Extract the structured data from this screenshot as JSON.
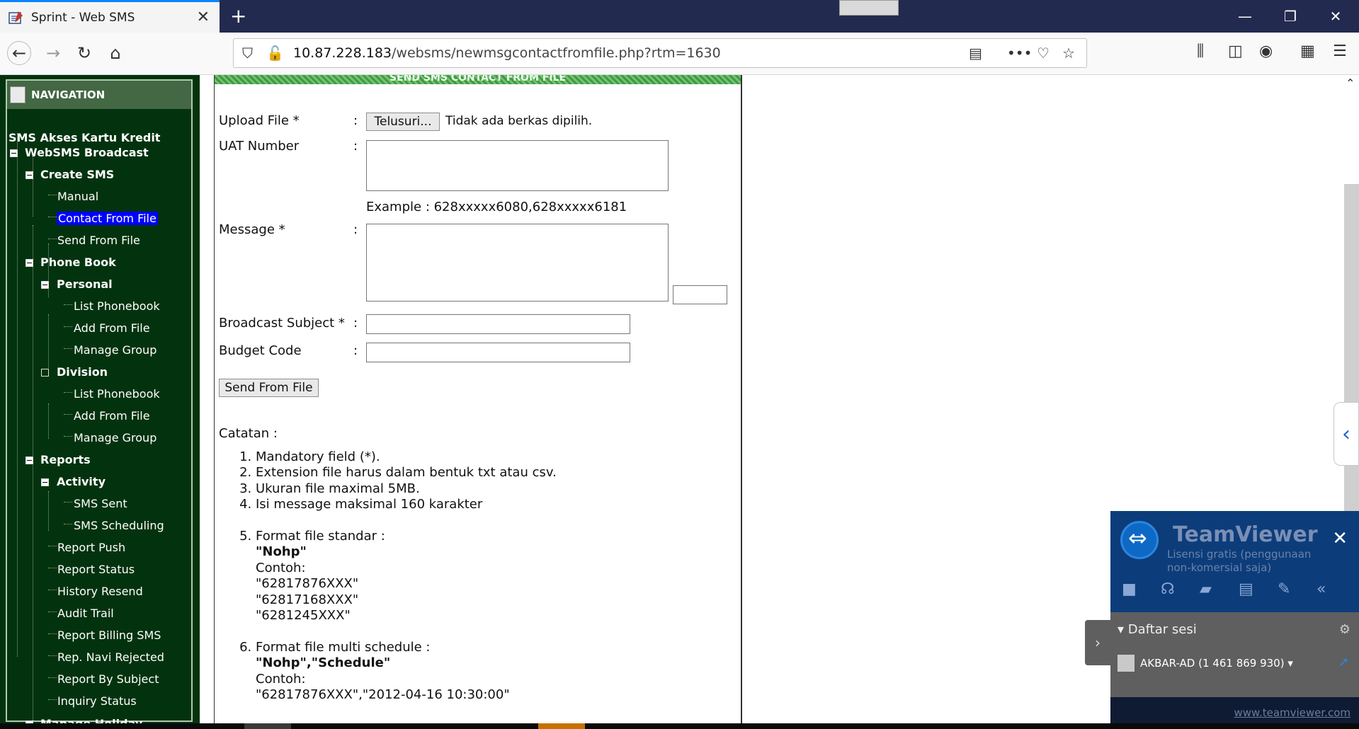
{
  "browser": {
    "tab_title": "Sprint - Web SMS",
    "new_tab": "+",
    "url_host": "10.87.228.183",
    "url_path": "/websms/newmsgcontactfromfile.php?rtm=1630"
  },
  "sidebar": {
    "header": "NAVIGATION",
    "section": "SMS Akses Kartu Kredit",
    "items": [
      {
        "label": "WebSMS Broadcast"
      },
      {
        "label": "Create SMS"
      },
      {
        "label": "Manual"
      },
      {
        "label": "Contact From File"
      },
      {
        "label": "Send From File"
      },
      {
        "label": "Phone Book"
      },
      {
        "label": "Personal"
      },
      {
        "label": "List Phonebook"
      },
      {
        "label": "Add From File"
      },
      {
        "label": "Manage Group"
      },
      {
        "label": "Division"
      },
      {
        "label": "List Phonebook"
      },
      {
        "label": "Add From File"
      },
      {
        "label": "Manage Group"
      },
      {
        "label": "Reports"
      },
      {
        "label": "Activity"
      },
      {
        "label": "SMS Sent"
      },
      {
        "label": "SMS Scheduling"
      },
      {
        "label": "Report Push"
      },
      {
        "label": "Report Status"
      },
      {
        "label": "History Resend"
      },
      {
        "label": "Audit Trail"
      },
      {
        "label": "Report Billing SMS"
      },
      {
        "label": "Rep. Navi Rejected"
      },
      {
        "label": "Report By Subject"
      },
      {
        "label": "Inquiry Status"
      },
      {
        "label": "Manage Holiday"
      }
    ]
  },
  "form": {
    "panel_title": "SEND SMS CONTACT FROM FILE",
    "colon": ":",
    "upload_label": "Upload File *",
    "browse_button": "Telusuri...",
    "no_file": "Tidak ada berkas dipilih.",
    "uat_label": "UAT Number",
    "uat_value": "",
    "example": "Example : 628xxxxx6080,628xxxxx6181",
    "message_label": "Message *",
    "message_value": "",
    "char_count": "",
    "subject_label": "Broadcast Subject *",
    "subject_value": "",
    "budget_label": "Budget Code",
    "budget_value": "",
    "send_button": "Send From File"
  },
  "notes": {
    "heading": "Catatan :",
    "items": [
      "Mandatory field (*).",
      "Extension file harus dalam bentuk txt atau csv.",
      "Ukuran file maximal 5MB.",
      "Isi message maksimal 160 karakter"
    ],
    "format_standard": {
      "title": "Format file standar :",
      "header": "\"Nohp\"",
      "contoh": "Contoh:",
      "rows": [
        "\"62817876XXX\"",
        "\"62817168XXX\"",
        "\"6281245XXX\""
      ]
    },
    "format_multi": {
      "title": "Format file multi schedule :",
      "header": "\"Nohp\",\"Schedule\"",
      "contoh": "Contoh:",
      "rows": [
        "\"62817876XXX\",\"2012-04-16 10:30:00\""
      ]
    }
  },
  "teamviewer": {
    "name": "TeamViewer",
    "license": "Lisensi gratis (penggunaan non-komersial saja)",
    "sessions": "Daftar sesi",
    "user": "AKBAR-AD (1 461 869 930)",
    "link": "www.teamviewer.com"
  },
  "colors": {
    "sidebar_bg": "#03330e",
    "selected_bg": "#0000ff",
    "tabbar_bg": "#232a4f"
  }
}
